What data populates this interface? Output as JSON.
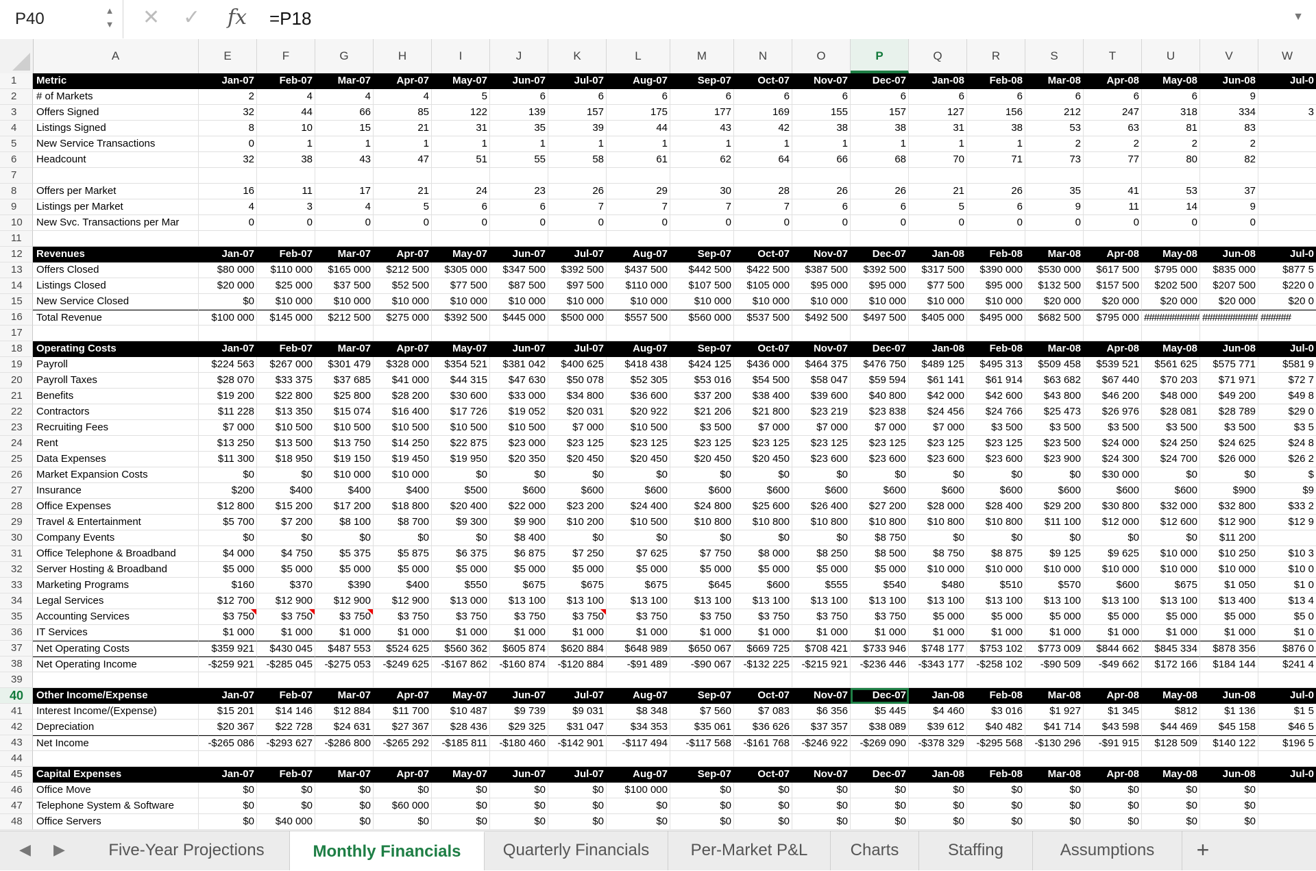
{
  "formula_bar": {
    "cell_ref": "P40",
    "formula": "=P18",
    "cancel_icon": "✕",
    "confirm_icon": "✓",
    "fx_label": "fx"
  },
  "columns": {
    "letters": [
      "A",
      "E",
      "F",
      "G",
      "H",
      "I",
      "J",
      "K",
      "L",
      "M",
      "N",
      "O",
      "P",
      "Q",
      "R",
      "S",
      "T",
      "U",
      "V",
      "W"
    ],
    "active": "P"
  },
  "active_row": 40,
  "selected_cell": {
    "row": 40,
    "col": "P"
  },
  "header_row": [
    "Jan-07",
    "Feb-07",
    "Mar-07",
    "Apr-07",
    "May-07",
    "Jun-07",
    "Jul-07",
    "Aug-07",
    "Sep-07",
    "Oct-07",
    "Nov-07",
    "Dec-07",
    "Jan-08",
    "Feb-08",
    "Mar-08",
    "Apr-08",
    "May-08",
    "Jun-08",
    "Jul-0"
  ],
  "rows": [
    {
      "n": 1,
      "type": "hdr",
      "label": "Metric"
    },
    {
      "n": 2,
      "label": "# of Markets",
      "cells": [
        "2",
        "4",
        "4",
        "4",
        "5",
        "6",
        "6",
        "6",
        "6",
        "6",
        "6",
        "6",
        "6",
        "6",
        "6",
        "6",
        "6",
        "9",
        ""
      ]
    },
    {
      "n": 3,
      "label": "Offers Signed",
      "cells": [
        "32",
        "44",
        "66",
        "85",
        "122",
        "139",
        "157",
        "175",
        "177",
        "169",
        "155",
        "157",
        "127",
        "156",
        "212",
        "247",
        "318",
        "334",
        "3"
      ]
    },
    {
      "n": 4,
      "label": "Listings Signed",
      "cells": [
        "8",
        "10",
        "15",
        "21",
        "31",
        "35",
        "39",
        "44",
        "43",
        "42",
        "38",
        "38",
        "31",
        "38",
        "53",
        "63",
        "81",
        "83",
        ""
      ]
    },
    {
      "n": 5,
      "label": "New Service Transactions",
      "cells": [
        "0",
        "1",
        "1",
        "1",
        "1",
        "1",
        "1",
        "1",
        "1",
        "1",
        "1",
        "1",
        "1",
        "1",
        "2",
        "2",
        "2",
        "2",
        ""
      ]
    },
    {
      "n": 6,
      "label": "Headcount",
      "cells": [
        "32",
        "38",
        "43",
        "47",
        "51",
        "55",
        "58",
        "61",
        "62",
        "64",
        "66",
        "68",
        "70",
        "71",
        "73",
        "77",
        "80",
        "82",
        ""
      ]
    },
    {
      "n": 7,
      "type": "blank"
    },
    {
      "n": 8,
      "label": "Offers per Market",
      "cells": [
        "16",
        "11",
        "17",
        "21",
        "24",
        "23",
        "26",
        "29",
        "30",
        "28",
        "26",
        "26",
        "21",
        "26",
        "35",
        "41",
        "53",
        "37",
        ""
      ]
    },
    {
      "n": 9,
      "label": "Listings per Market",
      "cells": [
        "4",
        "3",
        "4",
        "5",
        "6",
        "6",
        "7",
        "7",
        "7",
        "7",
        "6",
        "6",
        "5",
        "6",
        "9",
        "11",
        "14",
        "9",
        ""
      ]
    },
    {
      "n": 10,
      "label": "New Svc. Transactions per Mar",
      "cells": [
        "0",
        "0",
        "0",
        "0",
        "0",
        "0",
        "0",
        "0",
        "0",
        "0",
        "0",
        "0",
        "0",
        "0",
        "0",
        "0",
        "0",
        "0",
        ""
      ]
    },
    {
      "n": 11,
      "type": "blank"
    },
    {
      "n": 12,
      "type": "hdr",
      "label": "Revenues"
    },
    {
      "n": 13,
      "label": "Offers Closed",
      "cells": [
        "$80 000",
        "$110 000",
        "$165 000",
        "$212 500",
        "$305 000",
        "$347 500",
        "$392 500",
        "$437 500",
        "$442 500",
        "$422 500",
        "$387 500",
        "$392 500",
        "$317 500",
        "$390 000",
        "$530 000",
        "$617 500",
        "$795 000",
        "$835 000",
        "$877 5"
      ]
    },
    {
      "n": 14,
      "label": "Listings Closed",
      "cells": [
        "$20 000",
        "$25 000",
        "$37 500",
        "$52 500",
        "$77 500",
        "$87 500",
        "$97 500",
        "$110 000",
        "$107 500",
        "$105 000",
        "$95 000",
        "$95 000",
        "$77 500",
        "$95 000",
        "$132 500",
        "$157 500",
        "$202 500",
        "$207 500",
        "$220 0"
      ]
    },
    {
      "n": 15,
      "label": "New Service Closed",
      "cells": [
        "$0",
        "$10 000",
        "$10 000",
        "$10 000",
        "$10 000",
        "$10 000",
        "$10 000",
        "$10 000",
        "$10 000",
        "$10 000",
        "$10 000",
        "$10 000",
        "$10 000",
        "$10 000",
        "$20 000",
        "$20 000",
        "$20 000",
        "$20 000",
        "$20 0"
      ]
    },
    {
      "n": 16,
      "type": "total",
      "label": "Total Revenue",
      "cells": [
        "$100 000",
        "$145 000",
        "$212 500",
        "$275 000",
        "$392 500",
        "$445 000",
        "$500 000",
        "$557 500",
        "$560 000",
        "$537 500",
        "$492 500",
        "$497 500",
        "$405 000",
        "$495 000",
        "$682 500",
        "$795 000",
        "###########",
        "###########",
        "######"
      ]
    },
    {
      "n": 17,
      "type": "blank"
    },
    {
      "n": 18,
      "type": "hdr",
      "label": "Operating Costs"
    },
    {
      "n": 19,
      "label": "Payroll",
      "cells": [
        "$224 563",
        "$267 000",
        "$301 479",
        "$328 000",
        "$354 521",
        "$381 042",
        "$400 625",
        "$418 438",
        "$424 125",
        "$436 000",
        "$464 375",
        "$476 750",
        "$489 125",
        "$495 313",
        "$509 458",
        "$539 521",
        "$561 625",
        "$575 771",
        "$581 9"
      ]
    },
    {
      "n": 20,
      "label": "Payroll Taxes",
      "cells": [
        "$28 070",
        "$33 375",
        "$37 685",
        "$41 000",
        "$44 315",
        "$47 630",
        "$50 078",
        "$52 305",
        "$53 016",
        "$54 500",
        "$58 047",
        "$59 594",
        "$61 141",
        "$61 914",
        "$63 682",
        "$67 440",
        "$70 203",
        "$71 971",
        "$72 7"
      ]
    },
    {
      "n": 21,
      "label": "Benefits",
      "cells": [
        "$19 200",
        "$22 800",
        "$25 800",
        "$28 200",
        "$30 600",
        "$33 000",
        "$34 800",
        "$36 600",
        "$37 200",
        "$38 400",
        "$39 600",
        "$40 800",
        "$42 000",
        "$42 600",
        "$43 800",
        "$46 200",
        "$48 000",
        "$49 200",
        "$49 8"
      ]
    },
    {
      "n": 22,
      "label": "Contractors",
      "cells": [
        "$11 228",
        "$13 350",
        "$15 074",
        "$16 400",
        "$17 726",
        "$19 052",
        "$20 031",
        "$20 922",
        "$21 206",
        "$21 800",
        "$23 219",
        "$23 838",
        "$24 456",
        "$24 766",
        "$25 473",
        "$26 976",
        "$28 081",
        "$28 789",
        "$29 0"
      ]
    },
    {
      "n": 23,
      "label": "Recruiting Fees",
      "cells": [
        "$7 000",
        "$10 500",
        "$10 500",
        "$10 500",
        "$10 500",
        "$10 500",
        "$7 000",
        "$10 500",
        "$3 500",
        "$7 000",
        "$7 000",
        "$7 000",
        "$7 000",
        "$3 500",
        "$3 500",
        "$3 500",
        "$3 500",
        "$3 500",
        "$3 5"
      ]
    },
    {
      "n": 24,
      "label": "Rent",
      "cells": [
        "$13 250",
        "$13 500",
        "$13 750",
        "$14 250",
        "$22 875",
        "$23 000",
        "$23 125",
        "$23 125",
        "$23 125",
        "$23 125",
        "$23 125",
        "$23 125",
        "$23 125",
        "$23 125",
        "$23 500",
        "$24 000",
        "$24 250",
        "$24 625",
        "$24 8"
      ]
    },
    {
      "n": 25,
      "label": "Data Expenses",
      "cells": [
        "$11 300",
        "$18 950",
        "$19 150",
        "$19 450",
        "$19 950",
        "$20 350",
        "$20 450",
        "$20 450",
        "$20 450",
        "$20 450",
        "$23 600",
        "$23 600",
        "$23 600",
        "$23 600",
        "$23 900",
        "$24 300",
        "$24 700",
        "$26 000",
        "$26 2"
      ]
    },
    {
      "n": 26,
      "label": "Market Expansion Costs",
      "cells": [
        "$0",
        "$0",
        "$10 000",
        "$10 000",
        "$0",
        "$0",
        "$0",
        "$0",
        "$0",
        "$0",
        "$0",
        "$0",
        "$0",
        "$0",
        "$0",
        "$30 000",
        "$0",
        "$0",
        "$"
      ]
    },
    {
      "n": 27,
      "label": "Insurance",
      "cells": [
        "$200",
        "$400",
        "$400",
        "$400",
        "$500",
        "$600",
        "$600",
        "$600",
        "$600",
        "$600",
        "$600",
        "$600",
        "$600",
        "$600",
        "$600",
        "$600",
        "$600",
        "$900",
        "$9"
      ]
    },
    {
      "n": 28,
      "label": "Office Expenses",
      "cells": [
        "$12 800",
        "$15 200",
        "$17 200",
        "$18 800",
        "$20 400",
        "$22 000",
        "$23 200",
        "$24 400",
        "$24 800",
        "$25 600",
        "$26 400",
        "$27 200",
        "$28 000",
        "$28 400",
        "$29 200",
        "$30 800",
        "$32 000",
        "$32 800",
        "$33 2"
      ]
    },
    {
      "n": 29,
      "label": "Travel & Entertainment",
      "cells": [
        "$5 700",
        "$7 200",
        "$8 100",
        "$8 700",
        "$9 300",
        "$9 900",
        "$10 200",
        "$10 500",
        "$10 800",
        "$10 800",
        "$10 800",
        "$10 800",
        "$10 800",
        "$10 800",
        "$11 100",
        "$12 000",
        "$12 600",
        "$12 900",
        "$12 9"
      ]
    },
    {
      "n": 30,
      "label": "Company Events",
      "cells": [
        "$0",
        "$0",
        "$0",
        "$0",
        "$0",
        "$8 400",
        "$0",
        "$0",
        "$0",
        "$0",
        "$0",
        "$8 750",
        "$0",
        "$0",
        "$0",
        "$0",
        "$0",
        "$11 200",
        ""
      ]
    },
    {
      "n": 31,
      "label": "Office Telephone & Broadband",
      "cells": [
        "$4 000",
        "$4 750",
        "$5 375",
        "$5 875",
        "$6 375",
        "$6 875",
        "$7 250",
        "$7 625",
        "$7 750",
        "$8 000",
        "$8 250",
        "$8 500",
        "$8 750",
        "$8 875",
        "$9 125",
        "$9 625",
        "$10 000",
        "$10 250",
        "$10 3"
      ]
    },
    {
      "n": 32,
      "label": "Server Hosting & Broadband",
      "cells": [
        "$5 000",
        "$5 000",
        "$5 000",
        "$5 000",
        "$5 000",
        "$5 000",
        "$5 000",
        "$5 000",
        "$5 000",
        "$5 000",
        "$5 000",
        "$5 000",
        "$10 000",
        "$10 000",
        "$10 000",
        "$10 000",
        "$10 000",
        "$10 000",
        "$10 0"
      ]
    },
    {
      "n": 33,
      "label": "Marketing Programs",
      "cells": [
        "$160",
        "$370",
        "$390",
        "$400",
        "$550",
        "$675",
        "$675",
        "$675",
        "$645",
        "$600",
        "$555",
        "$540",
        "$480",
        "$510",
        "$570",
        "$600",
        "$675",
        "$1 050",
        "$1 0"
      ]
    },
    {
      "n": 34,
      "label": "Legal Services",
      "cells": [
        "$12 700",
        "$12 900",
        "$12 900",
        "$12 900",
        "$13 000",
        "$13 100",
        "$13 100",
        "$13 100",
        "$13 100",
        "$13 100",
        "$13 100",
        "$13 100",
        "$13 100",
        "$13 100",
        "$13 100",
        "$13 100",
        "$13 100",
        "$13 400",
        "$13 4"
      ]
    },
    {
      "n": 35,
      "label": "Accounting Services",
      "cells": [
        "$3 750",
        "$3 750",
        "$3 750",
        "$3 750",
        "$3 750",
        "$3 750",
        "$3 750",
        "$3 750",
        "$3 750",
        "$3 750",
        "$3 750",
        "$3 750",
        "$5 000",
        "$5 000",
        "$5 000",
        "$5 000",
        "$5 000",
        "$5 000",
        "$5 0"
      ],
      "comments": [
        0,
        1,
        2,
        6
      ]
    },
    {
      "n": 36,
      "label": "IT Services",
      "cells": [
        "$1 000",
        "$1 000",
        "$1 000",
        "$1 000",
        "$1 000",
        "$1 000",
        "$1 000",
        "$1 000",
        "$1 000",
        "$1 000",
        "$1 000",
        "$1 000",
        "$1 000",
        "$1 000",
        "$1 000",
        "$1 000",
        "$1 000",
        "$1 000",
        "$1 0"
      ]
    },
    {
      "n": 37,
      "type": "total",
      "label": "Net Operating Costs",
      "cells": [
        "$359 921",
        "$430 045",
        "$487 553",
        "$524 625",
        "$560 362",
        "$605 874",
        "$620 884",
        "$648 989",
        "$650 067",
        "$669 725",
        "$708 421",
        "$733 946",
        "$748 177",
        "$753 102",
        "$773 009",
        "$844 662",
        "$845 334",
        "$878 356",
        "$876 0"
      ]
    },
    {
      "n": 38,
      "type": "total",
      "label": "Net Operating Income",
      "cells": [
        "-$259 921",
        "-$285 045",
        "-$275 053",
        "-$249 625",
        "-$167 862",
        "-$160 874",
        "-$120 884",
        "-$91 489",
        "-$90 067",
        "-$132 225",
        "-$215 921",
        "-$236 446",
        "-$343 177",
        "-$258 102",
        "-$90 509",
        "-$49 662",
        "$172 166",
        "$184 144",
        "$241 4"
      ]
    },
    {
      "n": 39,
      "type": "blank"
    },
    {
      "n": 40,
      "type": "hdr",
      "label": "Other Income/Expense"
    },
    {
      "n": 41,
      "label": "Interest Income/(Expense)",
      "cells": [
        "$15 201",
        "$14 146",
        "$12 884",
        "$11 700",
        "$10 487",
        "$9 739",
        "$9 031",
        "$8 348",
        "$7 560",
        "$7 083",
        "$6 356",
        "$5 445",
        "$4 460",
        "$3 016",
        "$1 927",
        "$1 345",
        "$812",
        "$1 136",
        "$1 5"
      ]
    },
    {
      "n": 42,
      "label": "Depreciation",
      "cells": [
        "$20 367",
        "$22 728",
        "$24 631",
        "$27 367",
        "$28 436",
        "$29 325",
        "$31 047",
        "$34 353",
        "$35 061",
        "$36 626",
        "$37 357",
        "$38 089",
        "$39 612",
        "$40 482",
        "$41 714",
        "$43 598",
        "$44 469",
        "$45 158",
        "$46 5"
      ]
    },
    {
      "n": 43,
      "type": "total",
      "label": "Net Income",
      "cells": [
        "-$265 086",
        "-$293 627",
        "-$286 800",
        "-$265 292",
        "-$185 811",
        "-$180 460",
        "-$142 901",
        "-$117 494",
        "-$117 568",
        "-$161 768",
        "-$246 922",
        "-$269 090",
        "-$378 329",
        "-$295 568",
        "-$130 296",
        "-$91 915",
        "$128 509",
        "$140 122",
        "$196 5"
      ]
    },
    {
      "n": 44,
      "type": "blank"
    },
    {
      "n": 45,
      "type": "hdr",
      "label": "Capital Expenses"
    },
    {
      "n": 46,
      "label": "Office Move",
      "cells": [
        "$0",
        "$0",
        "$0",
        "$0",
        "$0",
        "$0",
        "$0",
        "$100 000",
        "$0",
        "$0",
        "$0",
        "$0",
        "$0",
        "$0",
        "$0",
        "$0",
        "$0",
        "$0",
        ""
      ]
    },
    {
      "n": 47,
      "label": "Telephone System & Software",
      "cells": [
        "$0",
        "$0",
        "$0",
        "$60 000",
        "$0",
        "$0",
        "$0",
        "$0",
        "$0",
        "$0",
        "$0",
        "$0",
        "$0",
        "$0",
        "$0",
        "$0",
        "$0",
        "$0",
        ""
      ]
    },
    {
      "n": 48,
      "label": "Office Servers",
      "cells": [
        "$0",
        "$40 000",
        "$0",
        "$0",
        "$0",
        "$0",
        "$0",
        "$0",
        "$0",
        "$0",
        "$0",
        "$0",
        "$0",
        "$0",
        "$0",
        "$0",
        "$0",
        "$0",
        ""
      ]
    }
  ],
  "tabs": [
    {
      "label": "Five-Year Projections",
      "active": false
    },
    {
      "label": "Monthly Financials",
      "active": true
    },
    {
      "label": "Quarterly Financials",
      "active": false
    },
    {
      "label": "Per-Market P&L",
      "active": false
    },
    {
      "label": "Charts",
      "active": false
    },
    {
      "label": "Staffing",
      "active": false
    },
    {
      "label": "Assumptions",
      "active": false
    }
  ],
  "add_tab_label": "+",
  "colors": {
    "accent": "#1e7e45",
    "header_bg": "#000000",
    "comment_marker": "#e00000"
  }
}
